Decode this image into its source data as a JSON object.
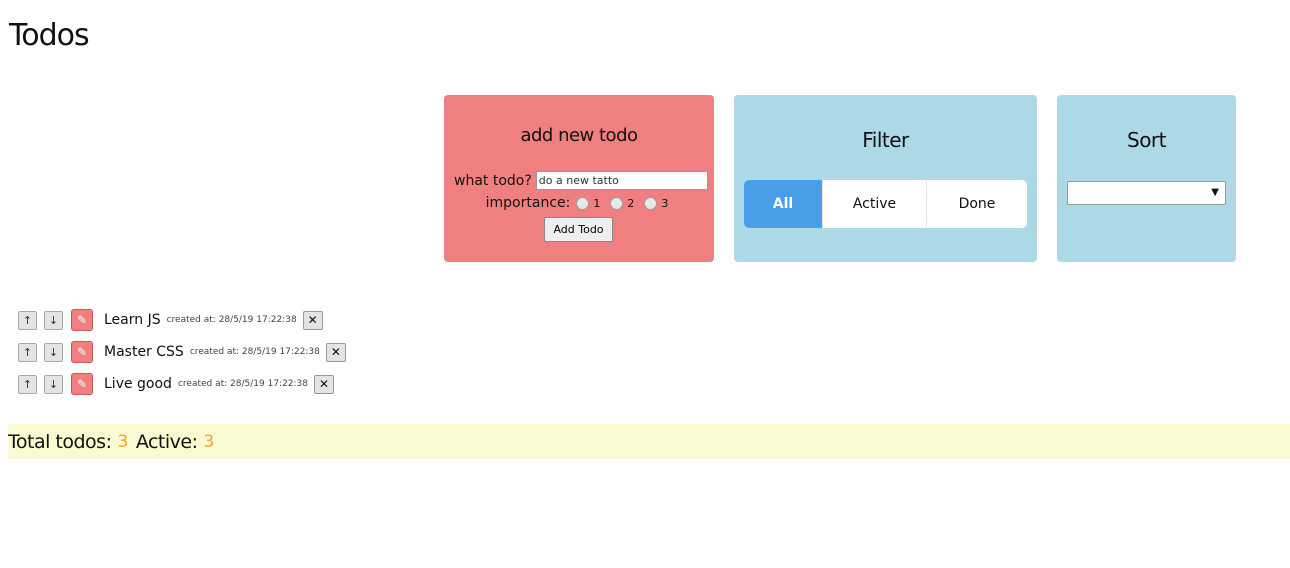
{
  "page": {
    "title": "Todos"
  },
  "add_form": {
    "title": "add new todo",
    "what_label": "what todo?",
    "input_value": "do a new tatto",
    "importance_label": "importance:",
    "options": [
      "1",
      "2",
      "3"
    ],
    "button_label": "Add Todo"
  },
  "filter": {
    "title": "Filter",
    "options": [
      "All",
      "Active",
      "Done"
    ],
    "selected": "All"
  },
  "sort": {
    "title": "Sort",
    "selected": ""
  },
  "todos": [
    {
      "text": "Learn JS",
      "created": "created at: 28/5/19 17:22:38"
    },
    {
      "text": "Master CSS",
      "created": "created at: 28/5/19 17:22:38"
    },
    {
      "text": "Live good",
      "created": "created at: 28/5/19 17:22:38"
    }
  ],
  "footer": {
    "total_label": "Total todos:",
    "total_count": "3",
    "active_label": "Active:",
    "active_count": "3"
  },
  "colors": {
    "add_panel": "#f08080",
    "filter_panel": "#add8e6",
    "filter_active": "#4a9de8",
    "footer_bg": "#fafad2",
    "count_accent": "#f5a623"
  }
}
